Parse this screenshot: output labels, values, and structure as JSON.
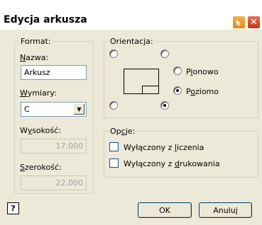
{
  "window": {
    "title": "Edycja arkusza"
  },
  "format": {
    "legend": "Format:",
    "name_label": "Nazwa:",
    "name_value": "Arkusz",
    "size_label": "Wymiary:",
    "size_value": "C",
    "height_label": "Wysokość:",
    "height_value": "17,000",
    "width_label": "Szerokość:",
    "width_value": "22,000"
  },
  "orientation": {
    "legend": "Orientacja:",
    "portrait_label": "Pionowo",
    "landscape_label": "Poziomo",
    "selected": "Poziomo"
  },
  "options": {
    "legend": "Opcje:",
    "exclude_calc_label": "Wyłączony z liczenia",
    "exclude_print_label": "Wyłączony z drukowania",
    "exclude_calc_checked": false,
    "exclude_print_checked": false
  },
  "buttons": {
    "ok": "OK",
    "cancel": "Anuluj",
    "help": "?"
  }
}
